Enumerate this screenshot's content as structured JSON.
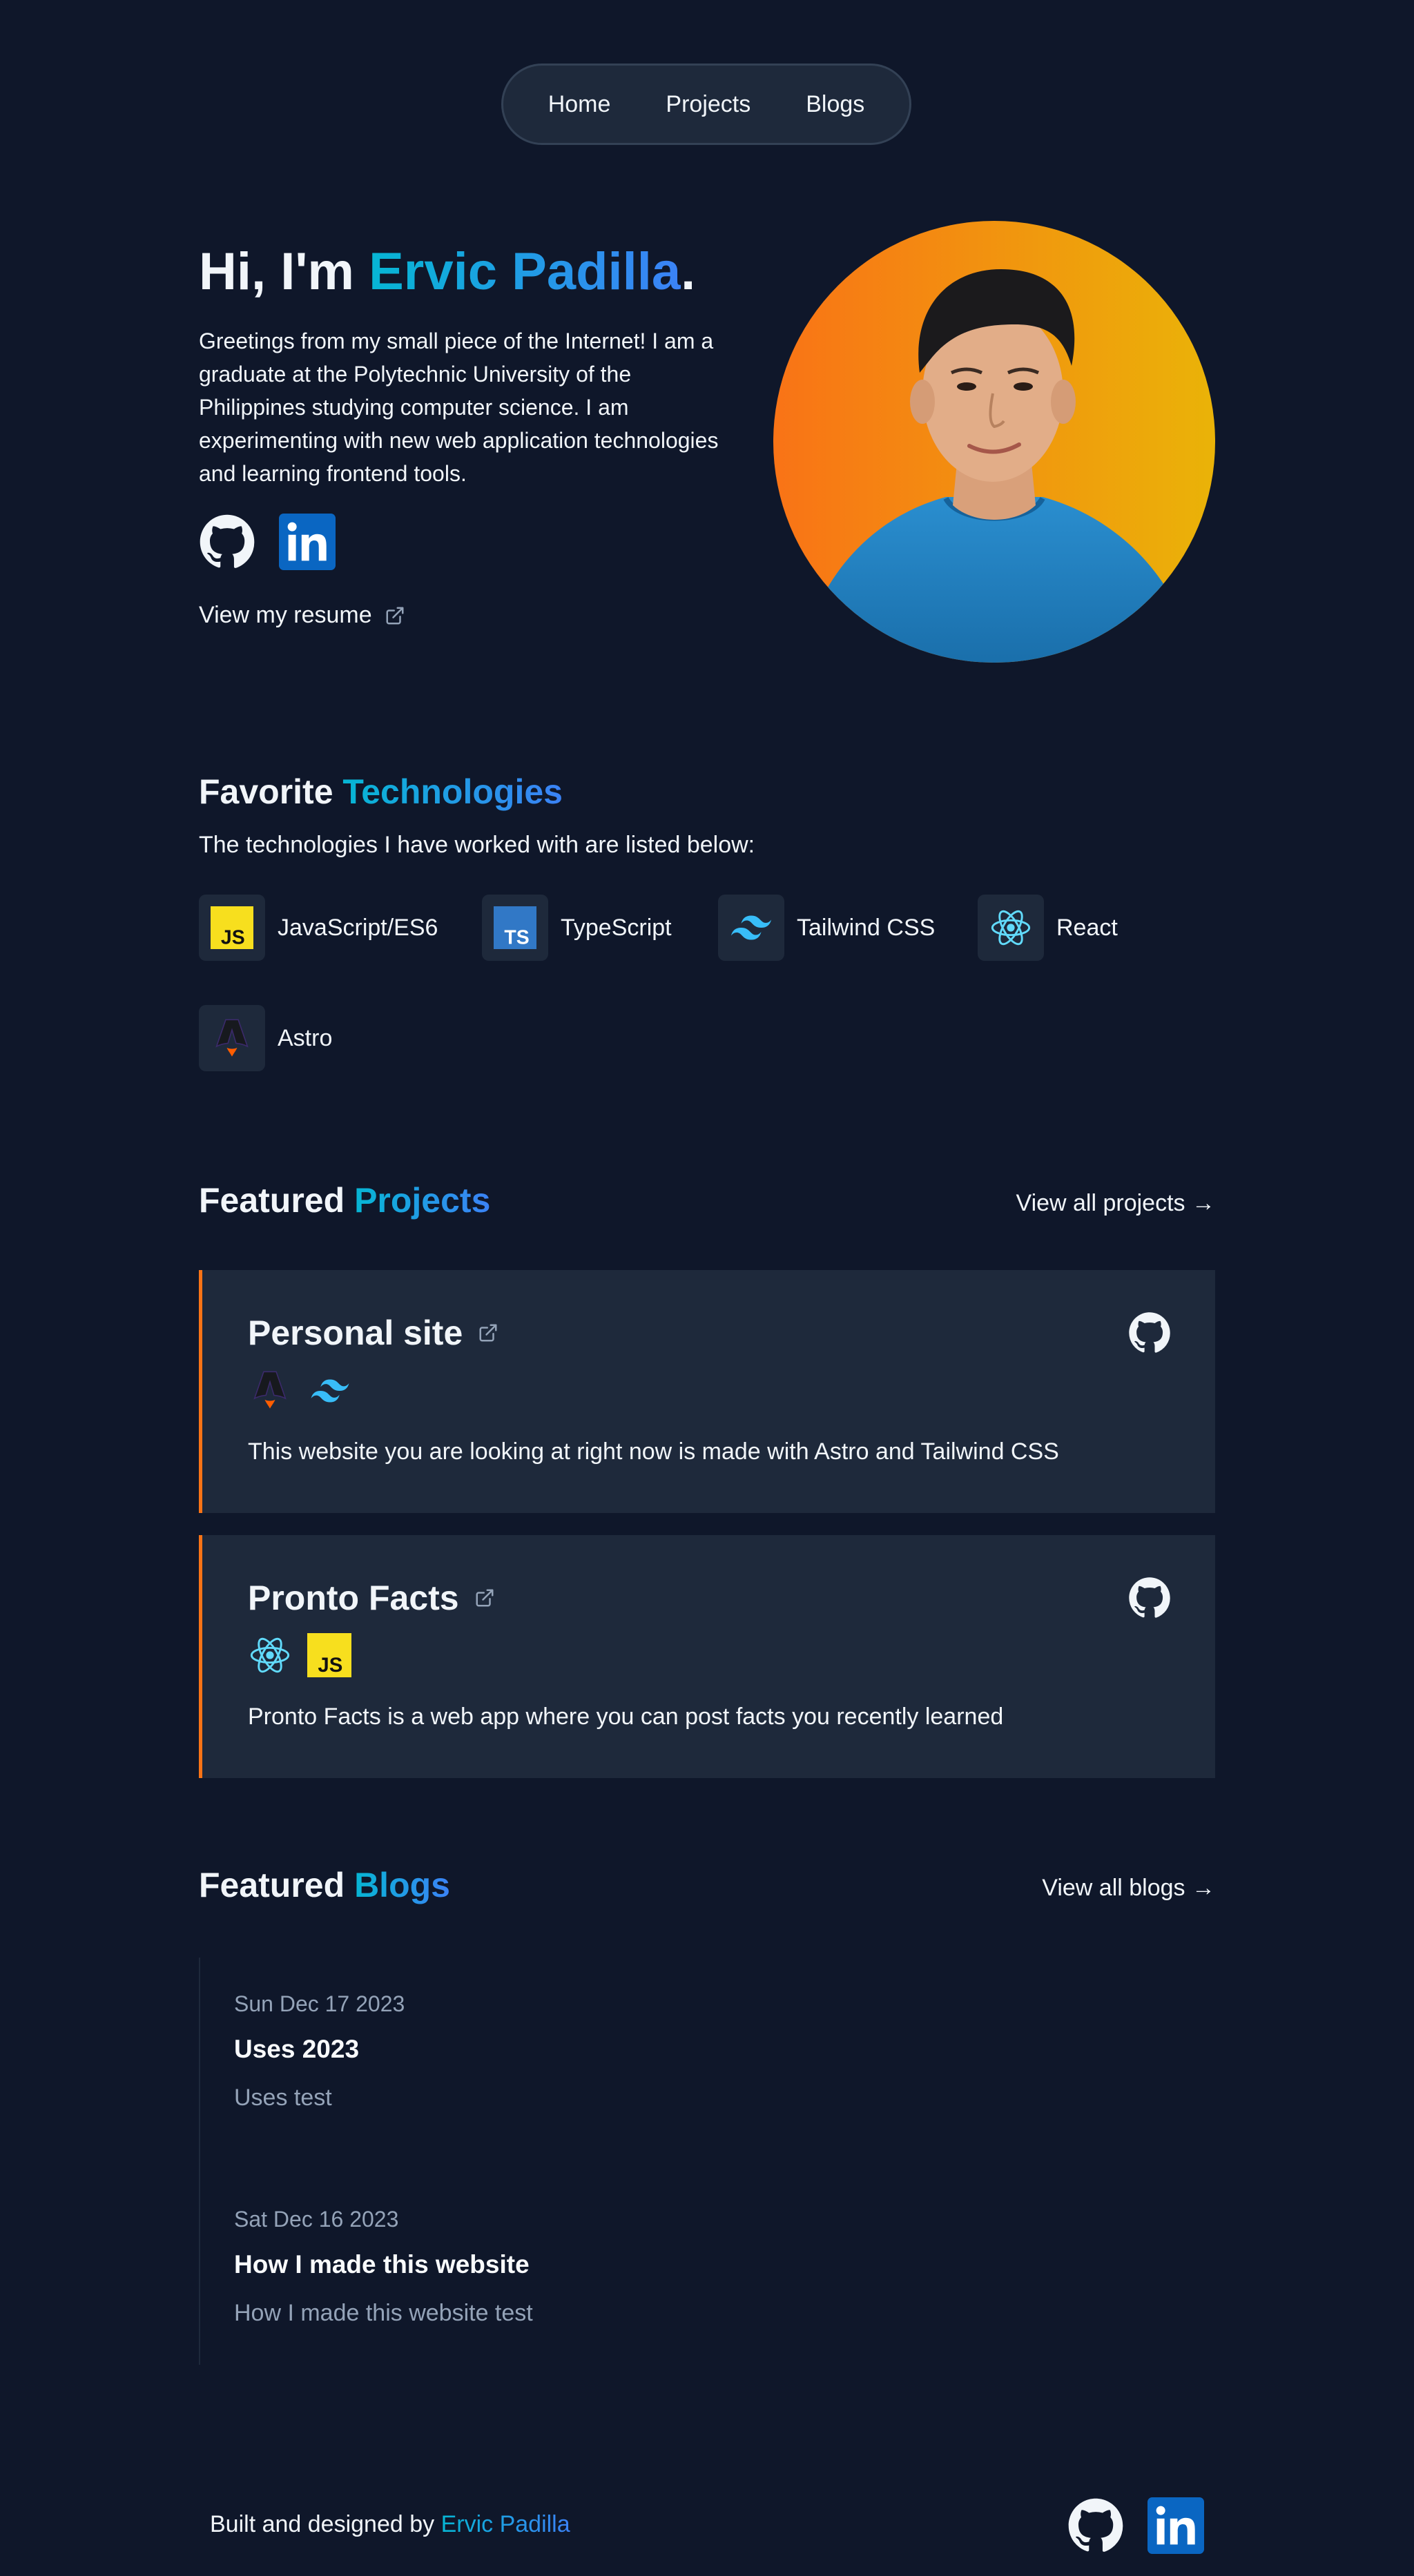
{
  "nav": {
    "items": [
      "Home",
      "Projects",
      "Blogs"
    ]
  },
  "hero": {
    "greeting": "Hi, I'm ",
    "name": "Ervic Padilla",
    "period": ".",
    "description": "Greetings from my small piece of the Internet! I am a graduate at the Polytechnic University of the Philippines studying computer science. I am experimenting with new web application technologies and learning frontend tools.",
    "social_icons": [
      "github-icon",
      "linkedin-icon"
    ],
    "resume_label": "View my resume",
    "avatar_gradient": [
      "#f97316",
      "#eab308"
    ]
  },
  "technologies": {
    "title_plain": "Favorite ",
    "title_accent": "Technologies",
    "subtitle": "The technologies I have worked with are listed below:",
    "items": [
      {
        "label": "JavaScript/ES6",
        "icon": "javascript-icon"
      },
      {
        "label": "TypeScript",
        "icon": "typescript-icon"
      },
      {
        "label": "Tailwind CSS",
        "icon": "tailwind-icon"
      },
      {
        "label": "React",
        "icon": "react-icon"
      },
      {
        "label": "Astro",
        "icon": "astro-icon"
      }
    ]
  },
  "projects": {
    "title_plain": "Featured ",
    "title_accent": "Projects",
    "view_all": "View all projects →",
    "items": [
      {
        "title": "Personal site",
        "techs": [
          "astro-icon",
          "tailwind-icon"
        ],
        "description": "This website you are looking at right now is made with Astro and Tailwind CSS"
      },
      {
        "title": "Pronto Facts",
        "techs": [
          "react-icon",
          "javascript-icon"
        ],
        "description": "Pronto Facts is a web app where you can post facts you recently learned"
      }
    ]
  },
  "blogs": {
    "title_plain": "Featured ",
    "title_accent": "Blogs",
    "view_all": "View all blogs →",
    "items": [
      {
        "date": "Sun Dec 17 2023",
        "title": "Uses 2023",
        "summary": "Uses test"
      },
      {
        "date": "Sat Dec 16 2023",
        "title": "How I made this website",
        "summary": "How I made this website test"
      }
    ]
  },
  "footer": {
    "text": "Built and designed by ",
    "name": "Ervic Padilla"
  },
  "colors": {
    "background": "#0f172a",
    "card": "#1e293b",
    "accent_start": "#06b6d4",
    "accent_end": "#3b82f6",
    "card_border": "#f97316"
  }
}
